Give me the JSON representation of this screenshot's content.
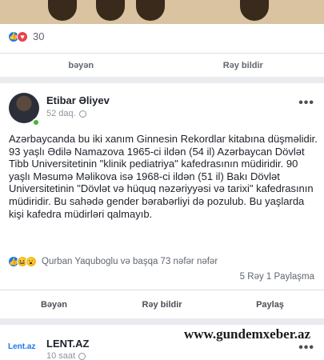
{
  "card1": {
    "reaction_count": "30",
    "actions": [
      "bəyən",
      "Rəy bildir"
    ]
  },
  "post": {
    "author": "Etibar Əliyev",
    "time": "52 daq.",
    "text": "Azərbaycanda bu iki xanım Ginnesin Rekordlar kitabına düşməlidir. 93 yaşlı Ədilə Namazova 1965-ci ildən (54 il) Azərbaycan Dövlət Tibb Universitetinin \"klinik pediatriya\" kafedrasının müdiridir. 90 yaşlı Məsumə Məlikova isə 1968-ci ildən (51 il) Bakı Dövlət Universitetinin \"Dövlət və hüquq nəzəriyyəsi və tarixi\" kafedrasının müdiridir. Bu sahədə gender bərabərliyi də pozulub. Bu yaşlarda kişi kafedra müdirləri qalmayıb.",
    "reactions_text": "Qurban Yaquboglu və başqa 73 nəfər nəfər",
    "stats": "5 Rəy  1 Paylaşma",
    "actions": [
      "Bəyən",
      "Rəy bildir",
      "Paylaş"
    ]
  },
  "card3": {
    "logo": "Lent.az",
    "author": "LENT.AZ",
    "time": "10 saat"
  },
  "watermark": "www.gundemxeber.az",
  "icons": {
    "like": "thumbs-up-icon",
    "love": "heart-icon",
    "haha": "laughing-face-icon",
    "wow": "surprised-face-icon",
    "more": "more-options-icon",
    "privacy": "globe-icon"
  },
  "colors": {
    "accent": "#1877f2",
    "online": "#42b72a",
    "love": "#e8434a"
  }
}
